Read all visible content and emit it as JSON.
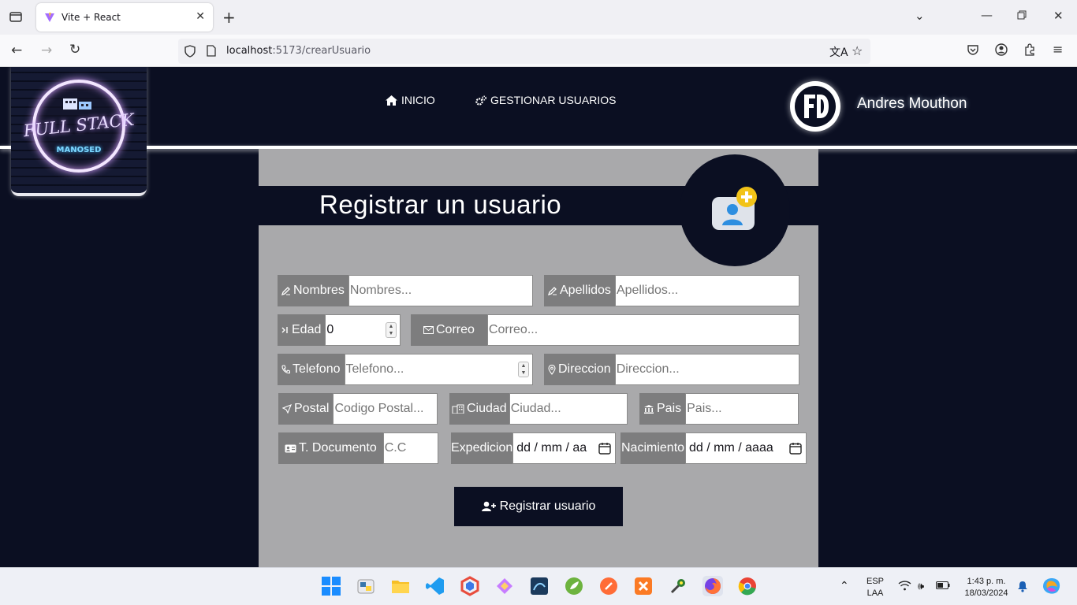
{
  "browser": {
    "tab_title": "Vite + React",
    "url_host": "localhost",
    "url_path": ":5173/crearUsuario"
  },
  "header": {
    "logo_text": "FULL STACK",
    "logo_sub": "MANOSED",
    "nav_inicio": "INICIO",
    "nav_gestionar": "GESTIONAR USUARIOS",
    "avatar_text": "FD",
    "user_name": "Andres Mouthon"
  },
  "form": {
    "title": "Registrar un usuario",
    "nombres_label": "Nombres",
    "nombres_placeholder": "Nombres...",
    "apellidos_label": "Apellidos",
    "apellidos_placeholder": "Apellidos...",
    "edad_label": "Edad",
    "edad_value": "0",
    "correo_label": "Correo",
    "correo_placeholder": "Correo...",
    "telefono_label": "Telefono",
    "telefono_placeholder": "Telefono...",
    "direccion_label": "Direccion",
    "direccion_placeholder": "Direccion...",
    "postal_label": "Postal",
    "postal_placeholder": "Codigo Postal...",
    "ciudad_label": "Ciudad",
    "ciudad_placeholder": "Ciudad...",
    "pais_label": "Pais",
    "pais_placeholder": "Pais...",
    "documento_label": "T. Documento",
    "documento_value": "C.C",
    "expedicion_label": "Expedicion",
    "expedicion_placeholder": "dd / mm / aa",
    "nacimiento_label": "Nacimiento",
    "nacimiento_placeholder": "dd / mm / aaaa",
    "submit_label": "Registrar usuario"
  },
  "taskbar": {
    "lang_top": "ESP",
    "lang_bottom": "LAA",
    "time": "1:43 p. m.",
    "date": "18/03/2024"
  },
  "colors": {
    "page_bg": "#0b0f22",
    "panel_bg": "#a9a9ab",
    "label_bg": "#7d7d7e"
  }
}
